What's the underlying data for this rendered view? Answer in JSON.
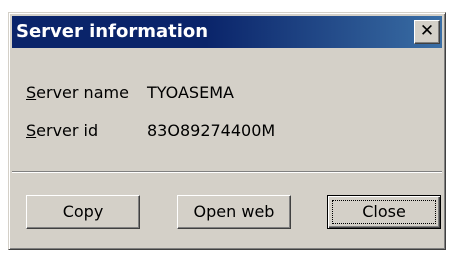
{
  "window": {
    "title": "Server information",
    "close_glyph": "✕"
  },
  "fields": {
    "server_name": {
      "label_first": "S",
      "label_rest": "erver name",
      "value": "TYOASEMA"
    },
    "server_id": {
      "label_first": "S",
      "label_rest": "erver id",
      "value": "83O89274400M"
    }
  },
  "buttons": {
    "copy": "Copy",
    "open_web": "Open web",
    "close": "Close"
  },
  "colors": {
    "titlebar": "#0a246a",
    "face": "#d4d0c8"
  }
}
